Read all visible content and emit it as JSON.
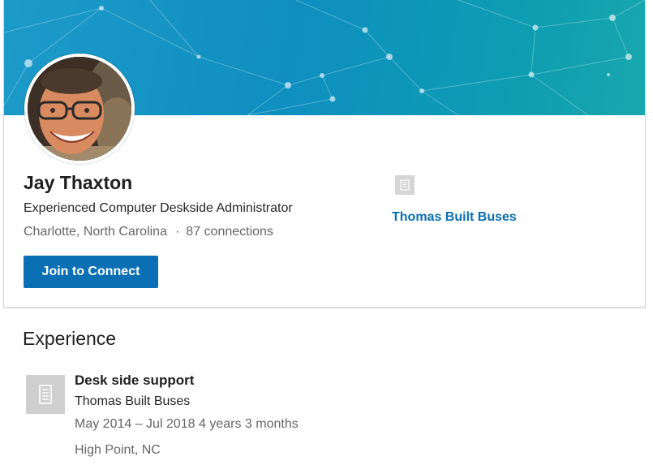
{
  "profile": {
    "name": "Jay Thaxton",
    "headline": "Experienced Computer Deskside Administrator",
    "location": "Charlotte, North Carolina",
    "separator": "·",
    "connections": "87 connections",
    "join_button_label": "Join to Connect",
    "current_company": "Thomas Built Buses",
    "company_logo_icon": "building-icon",
    "avatar_icon": "profile-photo"
  },
  "experience": {
    "title": "Experience",
    "items": [
      {
        "role": "Desk side support",
        "company": "Thomas Built Buses",
        "dates": "May 2014 – Jul 2018 4 years 3 months",
        "location": "High Point, NC",
        "logo_icon": "building-icon"
      }
    ]
  },
  "colors": {
    "brand_blue": "#0a6fb3",
    "banner_start": "#1d9ac8",
    "banner_end": "#19a7ad",
    "muted_text": "#666666",
    "logo_placeholder": "#cfcfcf"
  }
}
